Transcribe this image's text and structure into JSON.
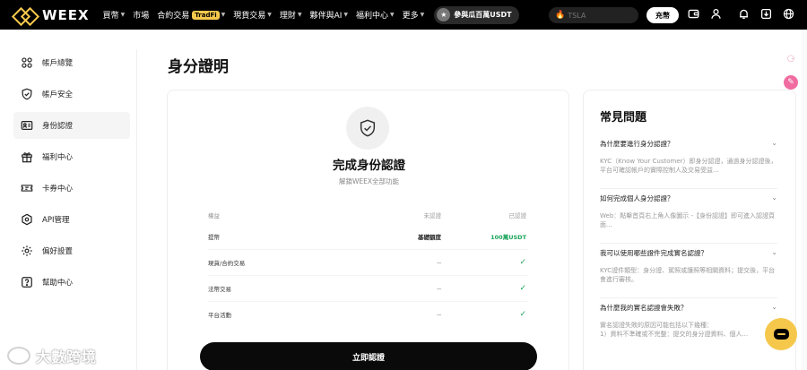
{
  "brand": {
    "name": "WEEX",
    "accent": "#f5c84c"
  },
  "nav": {
    "items": [
      {
        "label": "買幣",
        "caret": true
      },
      {
        "label": "市場",
        "caret": false
      },
      {
        "label": "合約交易",
        "caret": true,
        "badge": "TradFi"
      },
      {
        "label": "現貨交易",
        "caret": true
      },
      {
        "label": "理財",
        "caret": true
      },
      {
        "label": "夥伴與AI",
        "caret": true
      },
      {
        "label": "福利中心",
        "caret": true
      },
      {
        "label": "更多",
        "caret": true
      }
    ],
    "promo_label": "參與瓜百萬USDT",
    "search_placeholder": "TSLA",
    "deposit_label": "充幣"
  },
  "sidebar": {
    "items": [
      {
        "label": "帳戶總覽",
        "icon": "grid-icon",
        "active": false
      },
      {
        "label": "帳戶安全",
        "icon": "shield-icon",
        "active": false
      },
      {
        "label": "身份認證",
        "icon": "id-card-icon",
        "active": true
      },
      {
        "label": "福利中心",
        "icon": "gift-icon",
        "active": false
      },
      {
        "label": "卡券中心",
        "icon": "ticket-icon",
        "active": false
      },
      {
        "label": "API管理",
        "icon": "api-icon",
        "active": false
      },
      {
        "label": "偏好設置",
        "icon": "gear-icon",
        "active": false
      },
      {
        "label": "幫助中心",
        "icon": "help-icon",
        "active": false
      }
    ]
  },
  "page": {
    "title": "身分證明"
  },
  "kyc": {
    "title": "完成身份認證",
    "subtitle": "解鎖WEEX全部功能",
    "table": {
      "headers": [
        "權益",
        "未認證",
        "已認證"
      ],
      "rows": [
        {
          "name": "提幣",
          "unverified": "基礎額度",
          "verified": "100萬USDT",
          "verified_type": "text"
        },
        {
          "name": "現貨/合約交易",
          "unverified": "--",
          "verified": "✓",
          "verified_type": "check"
        },
        {
          "name": "法幣交易",
          "unverified": "--",
          "verified": "✓",
          "verified_type": "check"
        },
        {
          "name": "平台活動",
          "unverified": "--",
          "verified": "✓",
          "verified_type": "check"
        }
      ]
    },
    "button_label": "立即認證"
  },
  "faq": {
    "title": "常見問題",
    "items": [
      {
        "q": "為什麼要進行身分認證？",
        "a": "KYC（Know Your Customer）即身分認證，通過身分認證後，平台可確認帳戶的實際控制人及交易受益..."
      },
      {
        "q": "如何完成個人身分認證？",
        "a": "Web：點擊首頁右上角人像圖示 -【身份認證】即可進入認證頁面..."
      },
      {
        "q": "我可以使用哪些證件完成實名認證？",
        "a": "KYC證件類型：身分證、駕照或護照等相關資料；提交後，平台會進行審核。"
      },
      {
        "q": "為什麼我的實名認證會失敗？",
        "a": "實名認證失敗的原因可能包括以下幾種：\n1）資料不準確或不完整：提交的身分證資料、個人..."
      }
    ]
  },
  "watermark": {
    "text": "大數跨境"
  }
}
